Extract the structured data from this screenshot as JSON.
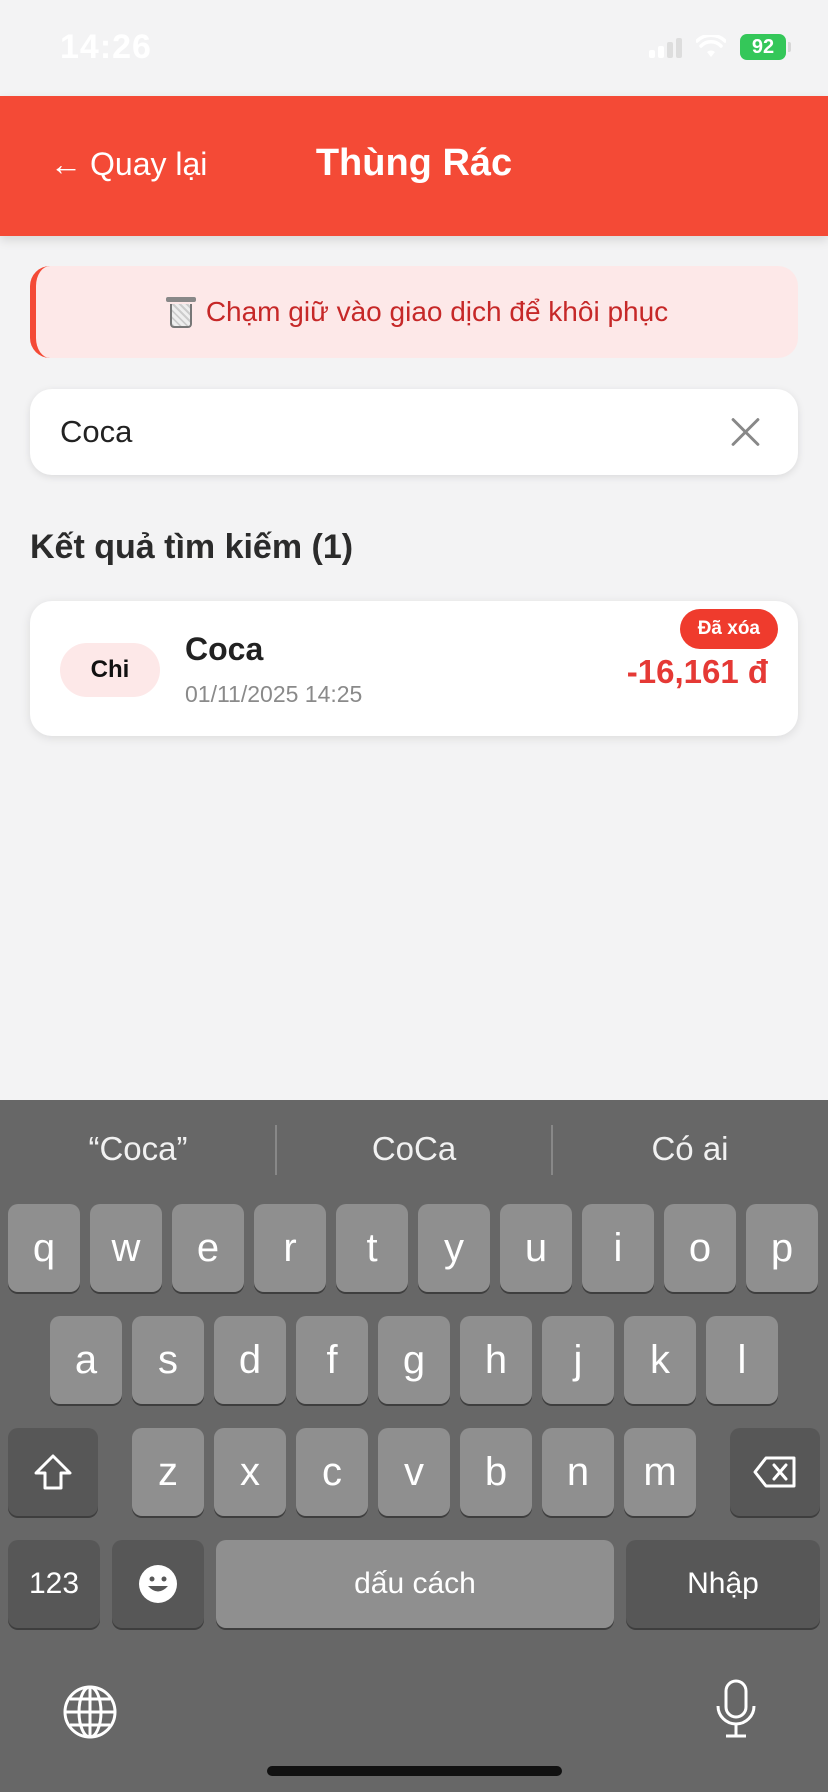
{
  "status_bar": {
    "time": "14:26",
    "battery": "92"
  },
  "header": {
    "back_label": "Quay lại",
    "back_arrow": "←",
    "title": "Thùng Rác"
  },
  "hint": {
    "text": "Chạm giữ vào giao dịch để khôi phục",
    "icon": "trash-can-icon"
  },
  "search": {
    "value": "Coca"
  },
  "results": {
    "heading": "Kết quả tìm kiếm (1)",
    "items": [
      {
        "type": "Chi",
        "title": "Coca",
        "datetime": "01/11/2025 14:25",
        "amount": "-16,161 đ",
        "status": "Đã xóa"
      }
    ]
  },
  "keyboard": {
    "suggestions": [
      "“Coca”",
      "CoCa",
      "Có ai"
    ],
    "row1": [
      "q",
      "w",
      "e",
      "r",
      "t",
      "y",
      "u",
      "i",
      "o",
      "p"
    ],
    "row2": [
      "a",
      "s",
      "d",
      "f",
      "g",
      "h",
      "j",
      "k",
      "l"
    ],
    "row3": [
      "z",
      "x",
      "c",
      "v",
      "b",
      "n",
      "m"
    ],
    "numbers_label": "123",
    "space_label": "dấu cách",
    "return_label": "Nhập"
  },
  "colors": {
    "accent": "#f44a36",
    "amount": "#e53935",
    "badge": "#ef3b2d",
    "keyboard_bg": "#676767"
  }
}
